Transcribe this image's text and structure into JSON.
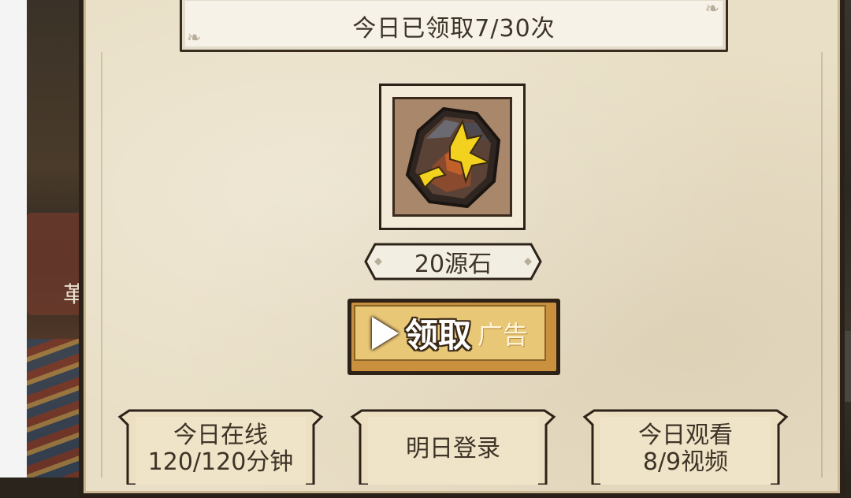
{
  "header": {
    "claimed_text": "今日已领取7/30次"
  },
  "reward": {
    "icon": "source-stone-icon",
    "label": "20源石"
  },
  "claim_button": {
    "label": "领取",
    "ad_label": "广告"
  },
  "tasks": [
    {
      "line1": "今日在线",
      "line2": "120/120分钟"
    },
    {
      "line1": "明日登录",
      "line2": ""
    },
    {
      "line1": "今日观看",
      "line2": "8/9视频"
    }
  ],
  "background": {
    "side_glyph": "革"
  },
  "colors": {
    "panel": "#e9dfc6",
    "button": "#e8c777",
    "accent_yellow": "#f2d21e",
    "text": "#3e3428"
  }
}
